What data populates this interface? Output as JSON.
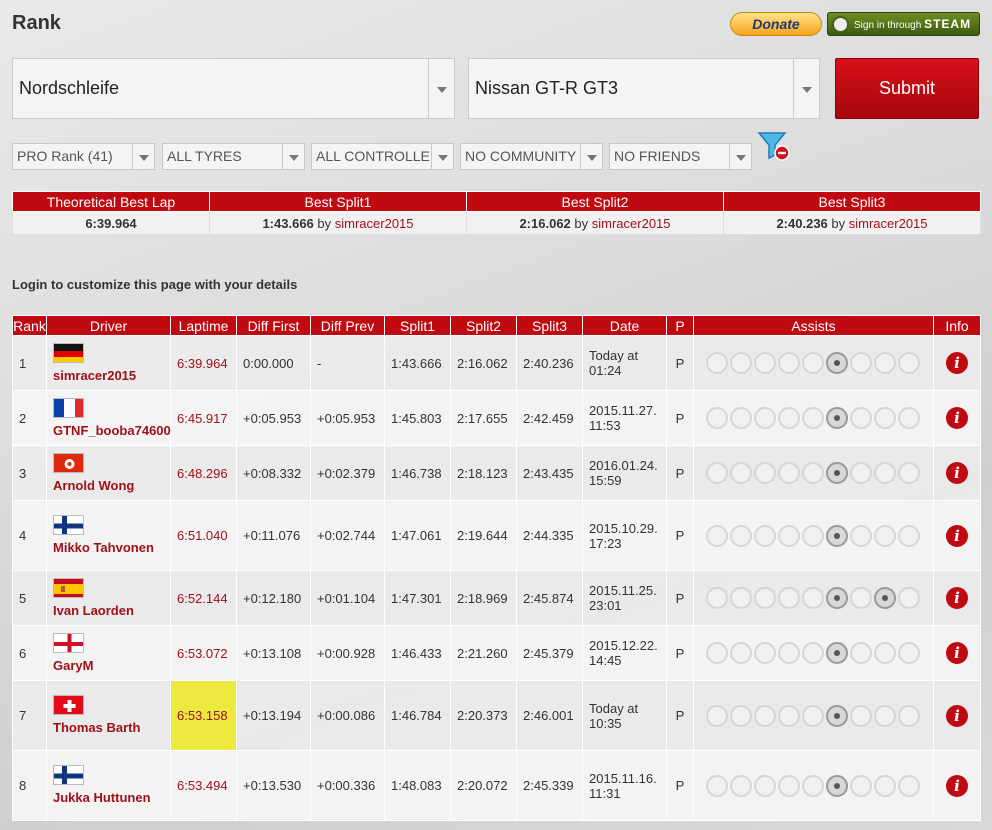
{
  "header": {
    "title": "Rank",
    "donate_label": "Donate",
    "steam_label_prefix": "Sign in through",
    "steam_label_brand": "STEAM"
  },
  "filters": {
    "track": "Nordschleife",
    "car": "Nissan GT-R GT3",
    "submit_label": "Submit",
    "rank": "PRO Rank (41)",
    "tyres": "ALL TYRES",
    "controllers": "ALL CONTROLLERS",
    "community": "NO COMMUNITY",
    "friends": "NO FRIENDS"
  },
  "best": {
    "headers": [
      "Theoretical Best Lap",
      "Best Split1",
      "Best Split2",
      "Best Split3"
    ],
    "theoretical": "6:39.964",
    "split1": {
      "time": "1:43.666",
      "by": "by",
      "driver": "simracer2015"
    },
    "split2": {
      "time": "2:16.062",
      "by": "by",
      "driver": "simracer2015"
    },
    "split3": {
      "time": "2:40.236",
      "by": "by",
      "driver": "simracer2015"
    }
  },
  "login_text": "Login to customize this page with your details",
  "table": {
    "headers": [
      "Rank",
      "Driver",
      "Laptime",
      "Diff First",
      "Diff Prev",
      "Split1",
      "Split2",
      "Split3",
      "Date",
      "P",
      "Assists",
      "Info"
    ],
    "rows": [
      {
        "rank": "1",
        "flag": "de",
        "driver": "simracer2015",
        "laptime": "6:39.964",
        "diff_first": "0:00.000",
        "diff_prev": "-",
        "split1": "1:43.666",
        "split2": "2:16.062",
        "split3": "2:40.236",
        "date1": "Today at",
        "date2": "01:24",
        "p": "P"
      },
      {
        "rank": "2",
        "flag": "fr",
        "driver": "GTNF_booba74600",
        "laptime": "6:45.917",
        "diff_first": "+0:05.953",
        "diff_prev": "+0:05.953",
        "split1": "1:45.803",
        "split2": "2:17.655",
        "split3": "2:42.459",
        "date1": "2015.11.27.",
        "date2": "11:53",
        "p": "P"
      },
      {
        "rank": "3",
        "flag": "hk",
        "driver": "Arnold Wong",
        "laptime": "6:48.296",
        "diff_first": "+0:08.332",
        "diff_prev": "+0:02.379",
        "split1": "1:46.738",
        "split2": "2:18.123",
        "split3": "2:43.435",
        "date1": "2016.01.24.",
        "date2": "15:59",
        "p": "P"
      },
      {
        "rank": "4",
        "flag": "fi",
        "driver": "Mikko Tahvonen",
        "laptime": "6:51.040",
        "diff_first": "+0:11.076",
        "diff_prev": "+0:02.744",
        "split1": "1:47.061",
        "split2": "2:19.644",
        "split3": "2:44.335",
        "date1": "2015.10.29.",
        "date2": "17:23",
        "p": "P"
      },
      {
        "rank": "5",
        "flag": "es",
        "driver": "Ivan Laorden",
        "laptime": "6:52.144",
        "diff_first": "+0:12.180",
        "diff_prev": "+0:01.104",
        "split1": "1:47.301",
        "split2": "2:18.969",
        "split3": "2:45.874",
        "date1": "2015.11.25.",
        "date2": "23:01",
        "p": "P"
      },
      {
        "rank": "6",
        "flag": "en",
        "driver": "GaryM",
        "laptime": "6:53.072",
        "diff_first": "+0:13.108",
        "diff_prev": "+0:00.928",
        "split1": "1:46.433",
        "split2": "2:21.260",
        "split3": "2:45.379",
        "date1": "2015.12.22.",
        "date2": "14:45",
        "p": "P"
      },
      {
        "rank": "7",
        "flag": "ch",
        "driver": "Thomas Barth",
        "laptime": "6:53.158",
        "diff_first": "+0:13.194",
        "diff_prev": "+0:00.086",
        "split1": "1:46.784",
        "split2": "2:20.373",
        "split3": "2:46.001",
        "date1": "Today at",
        "date2": "10:35",
        "p": "P",
        "highlight": true
      },
      {
        "rank": "8",
        "flag": "fi",
        "driver": "Jukka Huttunen",
        "laptime": "6:53.494",
        "diff_first": "+0:13.530",
        "diff_prev": "+0:00.336",
        "split1": "1:48.083",
        "split2": "2:20.072",
        "split3": "2:45.339",
        "date1": "2015.11.16.",
        "date2": "11:31",
        "p": "P"
      }
    ],
    "info_glyph": "i"
  },
  "colors": {
    "accent": "#c00a12",
    "highlight": "#ecea3e",
    "link": "#a0101a"
  },
  "icons": [
    "donate-button",
    "steam-logo-icon",
    "filter-funnel-icon",
    "assist-icon",
    "info-icon"
  ]
}
